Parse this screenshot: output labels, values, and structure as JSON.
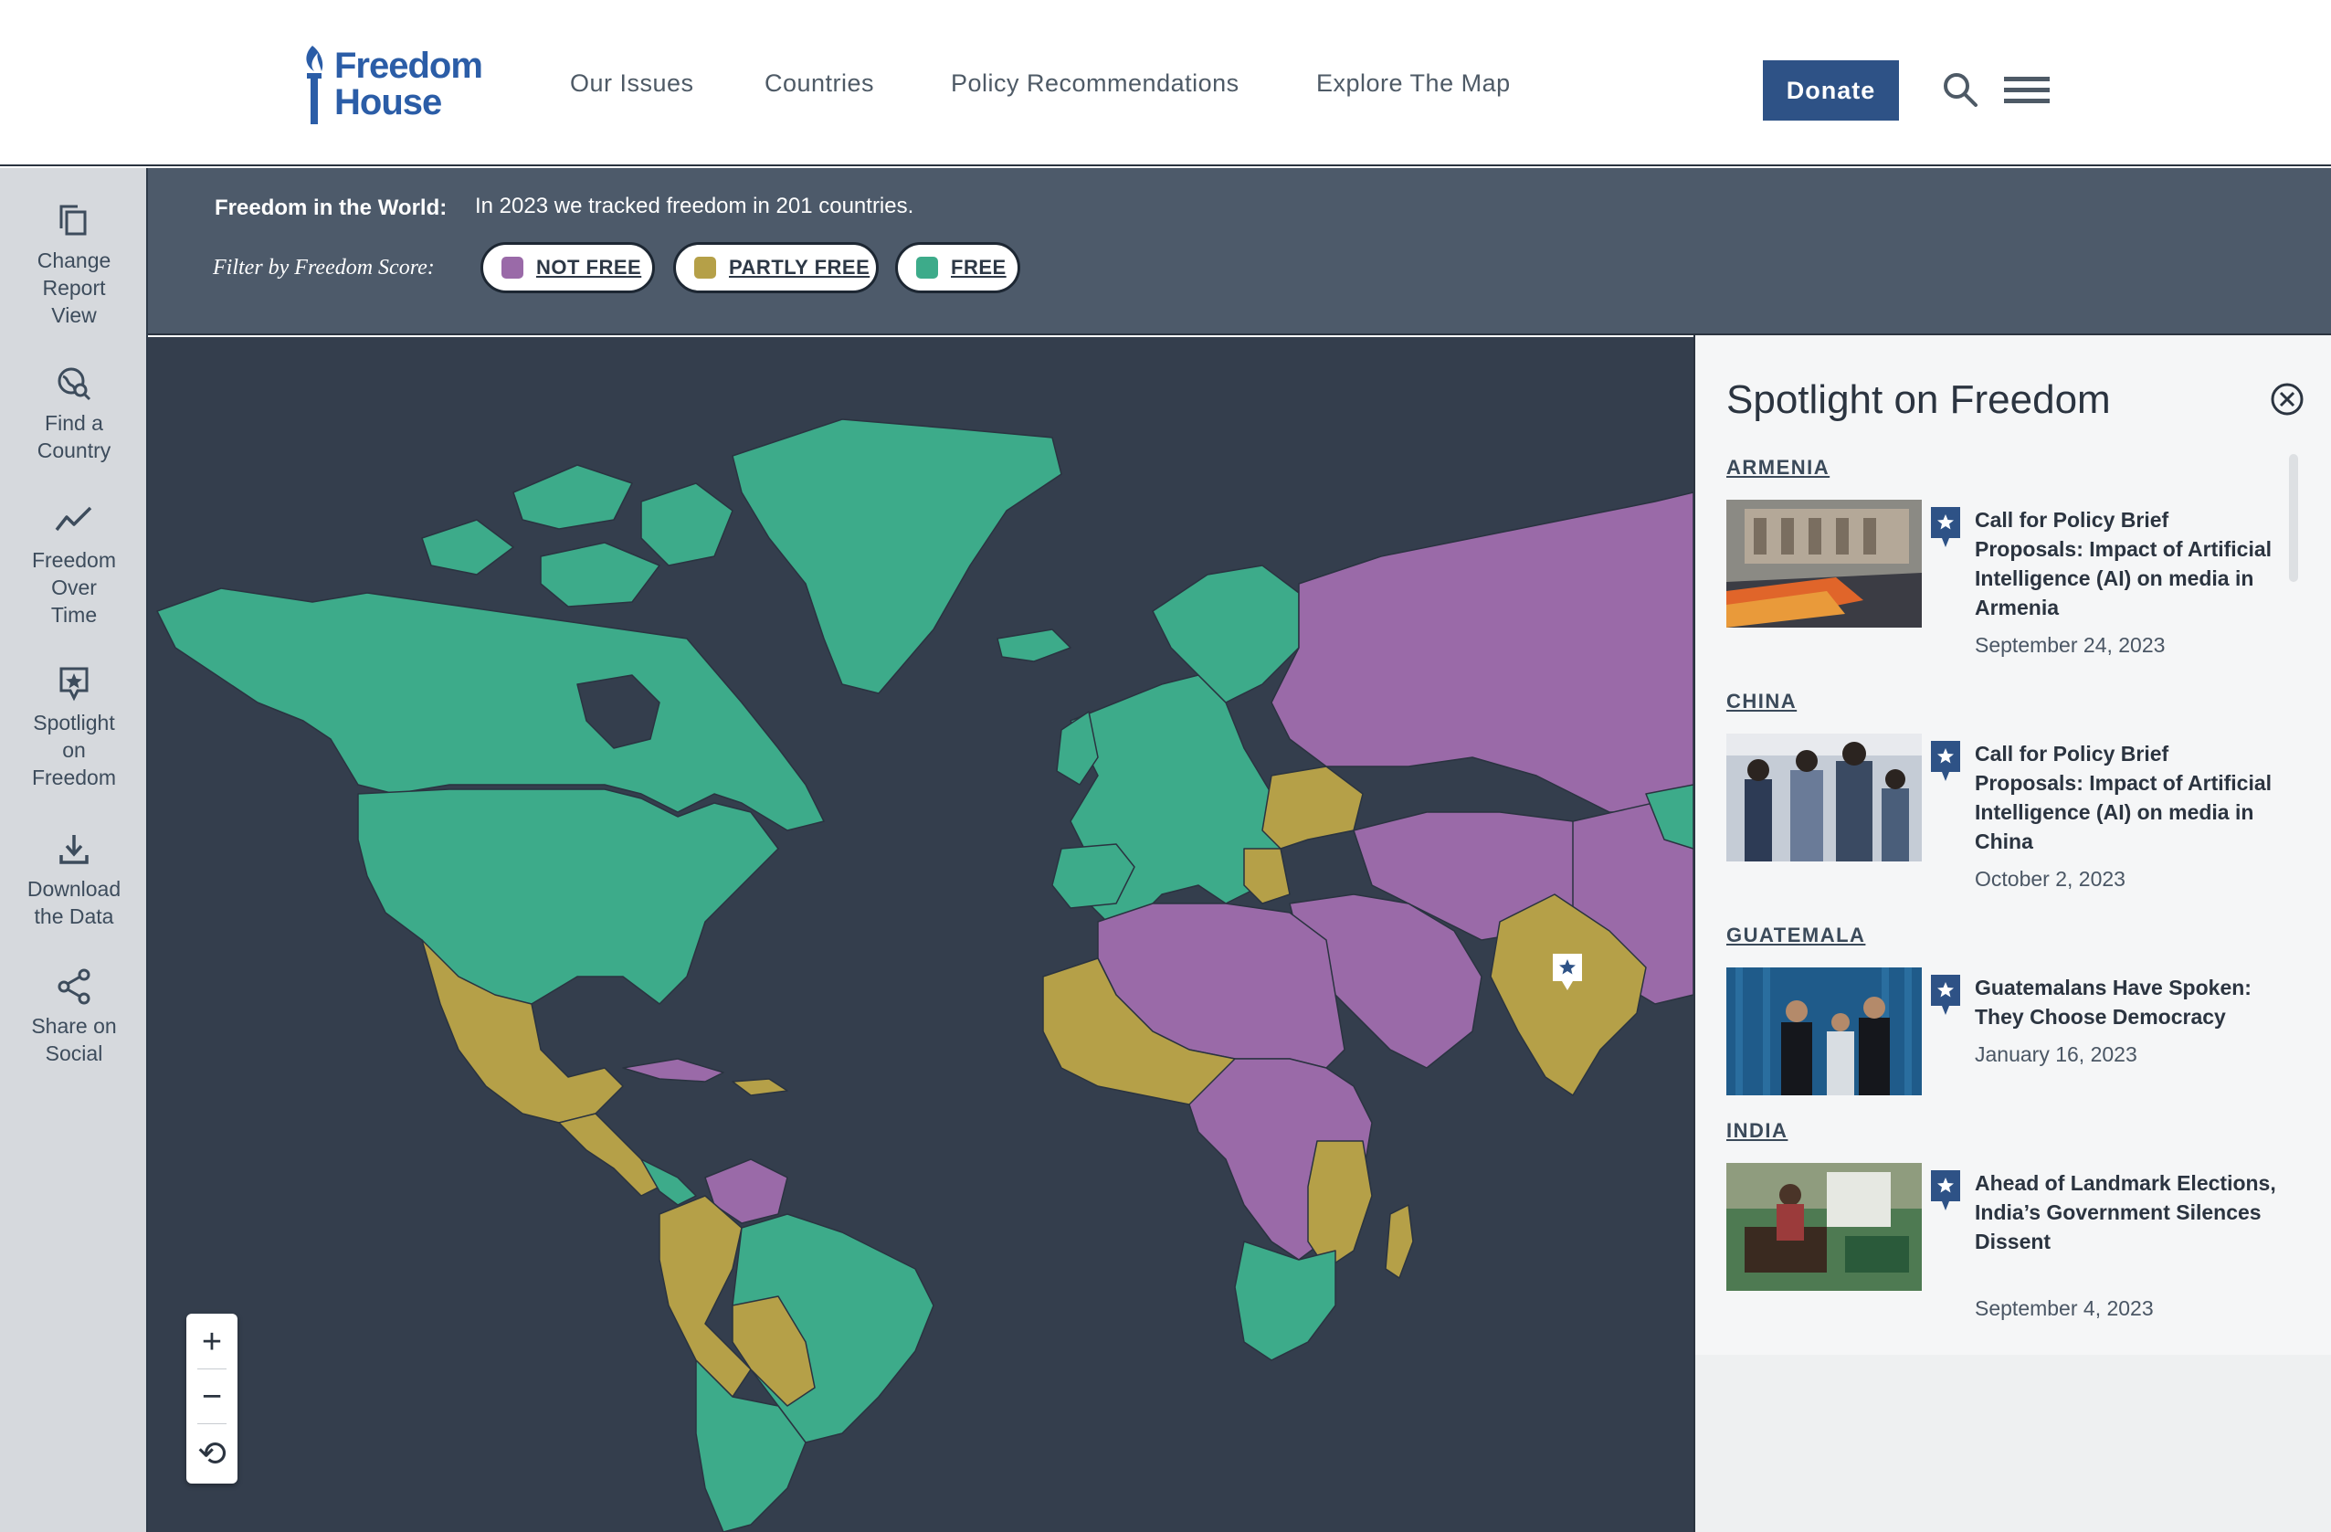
{
  "header": {
    "logo_line1": "Freedom",
    "logo_line2": "House",
    "nav": [
      "Our Issues",
      "Countries",
      "Policy Recommendations",
      "Explore The Map"
    ],
    "donate_label": "Donate",
    "icons": [
      "search-icon",
      "hamburger-menu-icon"
    ]
  },
  "sidebar": {
    "tools": [
      {
        "label": "Change\nReport\nView",
        "icon": "copy-pages-icon"
      },
      {
        "label": "Find a\nCountry",
        "icon": "globe-search-icon"
      },
      {
        "label": "Freedom\nOver\nTime",
        "icon": "trend-line-icon"
      },
      {
        "label": "Spotlight\non\nFreedom",
        "icon": "spotlight-star-icon"
      },
      {
        "label": "Download\nthe Data",
        "icon": "download-icon"
      },
      {
        "label": "Share on\nSocial",
        "icon": "share-icon"
      }
    ]
  },
  "filter": {
    "title": "Freedom in the World:",
    "subtitle": "In 2023 we tracked freedom in 201 countries.",
    "label": "Filter by Freedom Score:",
    "pills": [
      {
        "label": "NOT FREE",
        "color": "#9a6aa8"
      },
      {
        "label": "PARTLY FREE",
        "color": "#b5a048"
      },
      {
        "label": "FREE",
        "color": "#3dab8a"
      }
    ]
  },
  "map": {
    "ocean_color": "#343e4d",
    "status_colors": {
      "not_free": "#9a6aa8",
      "partly_free": "#b5a048",
      "free": "#3dab8a"
    },
    "zoom_controls": [
      "+",
      "−",
      "⟲"
    ]
  },
  "spotlight": {
    "title": "Spotlight on Freedom",
    "items": [
      {
        "country": "ARMENIA",
        "title": "Call for Policy Brief Proposals: Impact of Artificial Intelligence (AI) on media in Armenia",
        "date": "September 24, 2023"
      },
      {
        "country": "CHINA",
        "title": "Call for Policy Brief Proposals: Impact of Artificial Intelligence (AI) on media in China",
        "date": "October 2, 2023"
      },
      {
        "country": "GUATEMALA",
        "title": "Guatemalans Have Spoken: They Choose Democracy",
        "date": "January 16, 2023"
      },
      {
        "country": "INDIA",
        "title": "Ahead of Landmark Elections, India’s Government Silences Dissent",
        "date": "September 4, 2023"
      }
    ]
  }
}
